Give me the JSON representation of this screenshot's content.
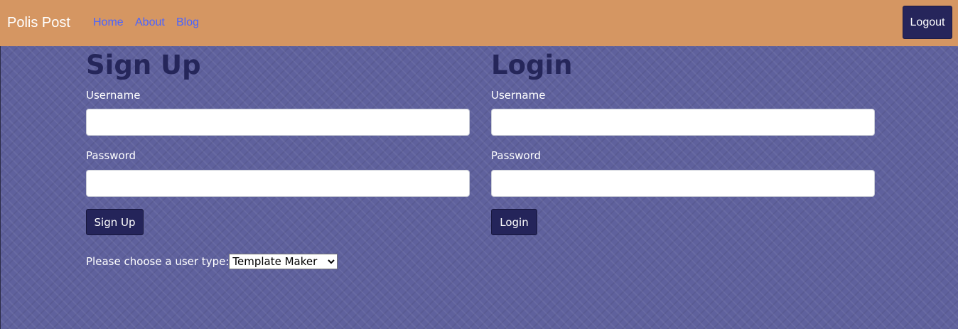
{
  "navbar": {
    "brand": "Polis Post",
    "links": [
      "Home",
      "About",
      "Blog"
    ],
    "logout_label": "Logout"
  },
  "signup": {
    "title": "Sign Up",
    "username_label": "Username",
    "username_value": "",
    "password_label": "Password",
    "password_value": "",
    "button_label": "Sign Up",
    "user_type_label": "Please choose a user type:",
    "user_type_selected": "Template Maker"
  },
  "login": {
    "title": "Login",
    "username_label": "Username",
    "username_value": "",
    "password_label": "Password",
    "password_value": "",
    "button_label": "Login"
  },
  "colors": {
    "navbar_bg": "#d59662",
    "page_bg": "#5f619d",
    "button_bg": "#24245a",
    "title_text": "#25265a",
    "nav_link": "#4a64ff"
  }
}
